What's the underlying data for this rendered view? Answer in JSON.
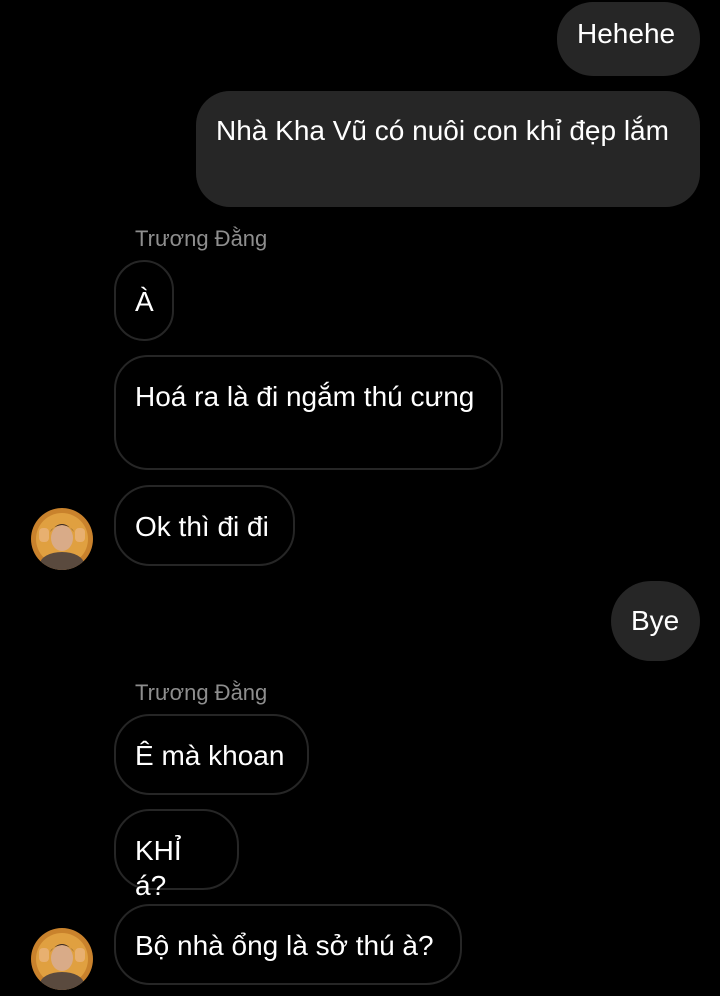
{
  "colors": {
    "background": "#000000",
    "sent_bubble": "#262626",
    "received_border": "#262626",
    "sender_name": "#8e8e8e",
    "text": "#ffffff"
  },
  "messages": [
    {
      "direction": "sent",
      "text": "Hehehe"
    },
    {
      "direction": "sent",
      "text": "Nhà Kha Vũ có nuôi con khỉ đẹp lắm"
    },
    {
      "direction": "sender",
      "text": "Trương Đằng"
    },
    {
      "direction": "received",
      "text": "À"
    },
    {
      "direction": "received",
      "text": "Hoá ra là đi ngắm thú cưng"
    },
    {
      "direction": "received",
      "text": "Ok thì đi đi"
    },
    {
      "direction": "sent",
      "text": "Bye"
    },
    {
      "direction": "sender",
      "text": "Trương Đằng"
    },
    {
      "direction": "received",
      "text": "Ê mà khoan"
    },
    {
      "direction": "received",
      "text": "KHỈ á?"
    },
    {
      "direction": "received",
      "text": "Bộ nhà ổng là sở thú à?"
    }
  ],
  "avatar_icon": "user-avatar-photo"
}
